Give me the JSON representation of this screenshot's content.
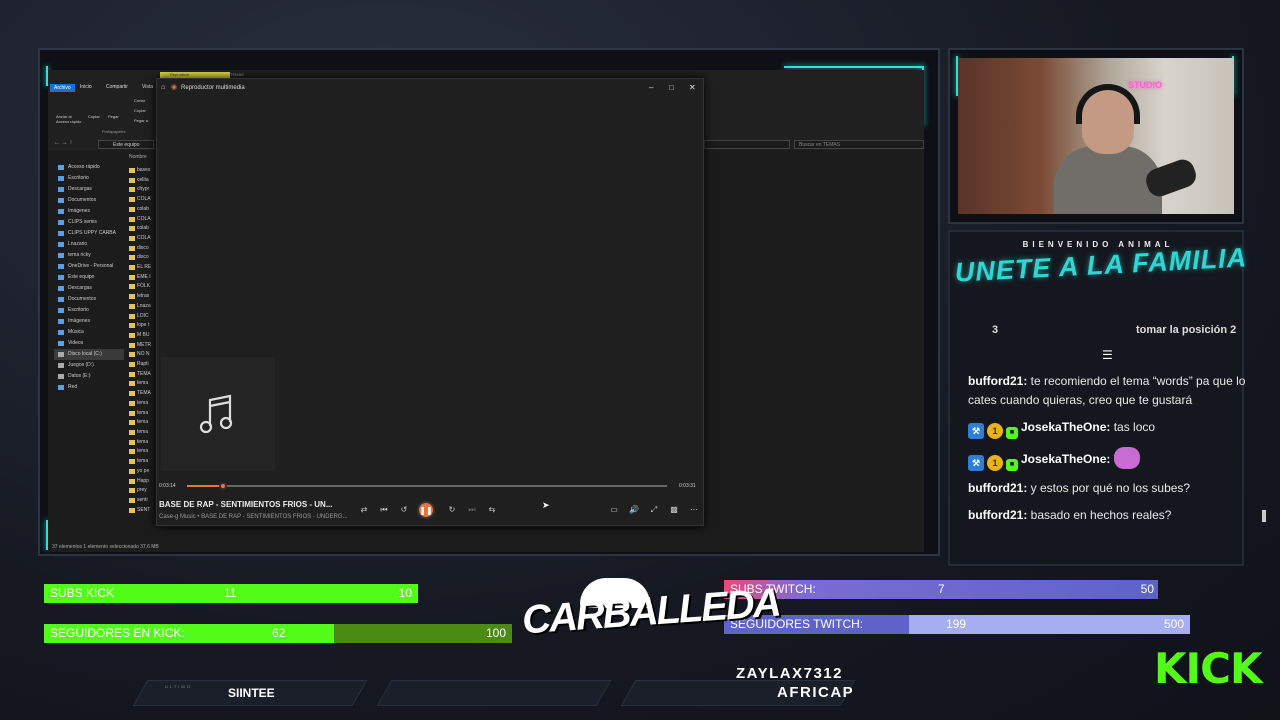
{
  "explorer": {
    "tabs": [
      "Archivo",
      "Inicio",
      "Compartir",
      "Vista"
    ],
    "clipboard": [
      "Anclar al Acceso rápido",
      "Copiar",
      "Pegar"
    ],
    "clip_items": [
      "Cortar",
      "Copiar",
      "Pegar a"
    ],
    "group_label": "Portapapeles",
    "address": "Este equipo",
    "search_placeholder": "Buscar en TEMAS",
    "column_name": "Nombre",
    "nav": [
      {
        "label": "Acceso rápido",
        "cls": ""
      },
      {
        "label": "Escritorio",
        "cls": ""
      },
      {
        "label": "Descargas",
        "cls": ""
      },
      {
        "label": "Documentos",
        "cls": ""
      },
      {
        "label": "Imágenes",
        "cls": ""
      },
      {
        "label": "CLIPS semis",
        "cls": ""
      },
      {
        "label": "CLIPS UPPY CARBA",
        "cls": ""
      },
      {
        "label": "Lnazario",
        "cls": ""
      },
      {
        "label": "tema ricky",
        "cls": ""
      },
      {
        "label": "",
        "cls": ""
      },
      {
        "label": "OneDrive - Personal",
        "cls": ""
      },
      {
        "label": "",
        "cls": ""
      },
      {
        "label": "Este equipo",
        "cls": ""
      },
      {
        "label": "Descargas",
        "cls": ""
      },
      {
        "label": "Documentos",
        "cls": ""
      },
      {
        "label": "Escritorio",
        "cls": ""
      },
      {
        "label": "Imágenes",
        "cls": ""
      },
      {
        "label": "Música",
        "cls": ""
      },
      {
        "label": "Videos",
        "cls": ""
      },
      {
        "label": "Disco local (C:)",
        "cls": "drive hl"
      },
      {
        "label": "Juegos (D:)",
        "cls": "drive"
      },
      {
        "label": "Datos (E:)",
        "cls": "drive"
      },
      {
        "label": "",
        "cls": ""
      },
      {
        "label": "Red",
        "cls": ""
      }
    ],
    "files": [
      "bases",
      "celita",
      "chypr",
      "COLA",
      "colab",
      "COLA",
      "colab",
      "COLA",
      "disco",
      "disco",
      "EL RE",
      "EME I",
      "FOLK",
      "letras",
      "Lnaza",
      "LOIC",
      "lope t",
      "M BU",
      "METR",
      "NO N",
      "Rapti",
      "TEMA",
      "tema",
      "TEMA",
      "tema",
      "tema",
      "tema",
      "tema",
      "tema",
      "tema",
      "tema",
      "yo pe",
      "Happ",
      "prey",
      "senti",
      "SENT"
    ],
    "status": "37 elementos   1 elemento seleccionado  37,6 MB"
  },
  "player": {
    "strip": "Reproducir",
    "strip2": "TEMAS",
    "window_title": "Reproductor multimedia",
    "elapsed": "0:03:14",
    "total": "0:03:31",
    "progress": 0.075,
    "track_title": "BASE DE RAP - SENTIMIENTOS FRIOS - UN...",
    "track_meta": "Case-g Music • BASE DE RAP - SENTIMIENTOS FRIOS - UNDERG...",
    "accent": "#e8743b"
  },
  "cam": {
    "neon": "STUDIO"
  },
  "chat": {
    "welcome": "BIENVENIDO ANIMAL",
    "banner": "UNETE A LA FAMILIA",
    "partial_left": "3",
    "partial_right": "tomar la posición 2",
    "messages": [
      {
        "user": "bufford21:",
        "text": " te recomiendo el tema “words” pa que lo cates cuando quieras, creo que te gustará",
        "badges": false,
        "emote": false
      },
      {
        "user": "JosekaTheOne:",
        "text": " tas loco",
        "badges": true,
        "emote": false
      },
      {
        "user": "JosekaTheOne:",
        "text": " ",
        "badges": true,
        "emote": true
      },
      {
        "user": "bufford21:",
        "text": " y estos por qué no los subes?",
        "badges": false,
        "emote": false
      },
      {
        "user": "bufford21:",
        "text": " basado en hechos reales?",
        "badges": false,
        "emote": false
      }
    ]
  },
  "stats": {
    "subs_kick": {
      "label": "SUBS KICK",
      "value": "11",
      "goal": "10",
      "fill": 1.0
    },
    "seg_kick": {
      "label": "SEGUIDORES EN KICK:",
      "value": "62",
      "goal": "100",
      "fill": 0.62
    },
    "subs_twitch": {
      "label": "SUBS TWITCH:",
      "value": "7",
      "goal": "50",
      "fill": 1.0
    },
    "seg_twitch": {
      "label": "SEGUIDORES TWITCH:",
      "value": "199",
      "goal": "500",
      "fill": 0.398
    }
  },
  "branding": {
    "logo": "CARBALLEDA",
    "names": [
      "ZAYLAX7312",
      "AFRICAP"
    ],
    "kick": "KICK",
    "last_label": "ULTIMO",
    "last_name": "SIINTEE"
  },
  "colors": {
    "kick_green": "#53fc18",
    "teal": "#29e3d6",
    "twitch_purple": "#5d63c9"
  }
}
